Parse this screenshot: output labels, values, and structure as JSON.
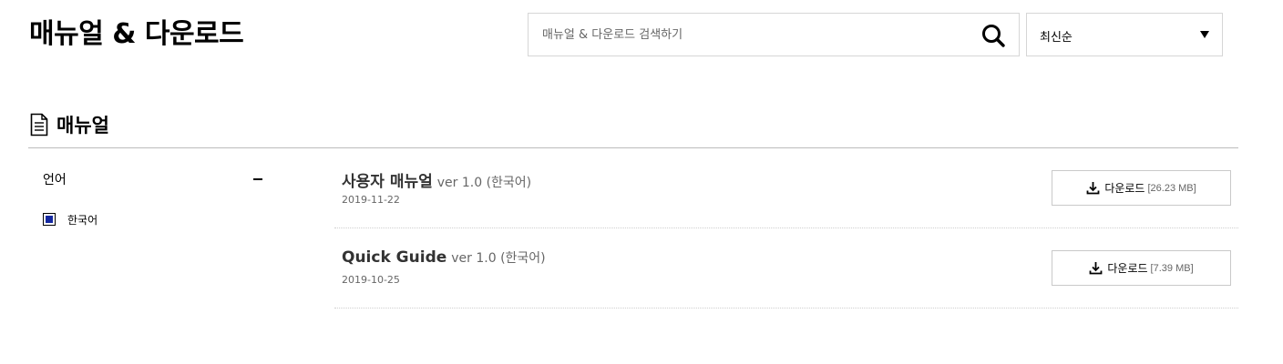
{
  "header": {
    "title": "매뉴얼 & 다운로드",
    "search": {
      "placeholder": "매뉴얼 & 다운로드 검색하기",
      "value": "",
      "icon": "search-icon"
    },
    "sort": {
      "selected": "최신순",
      "icon": "caret-down-icon"
    }
  },
  "section": {
    "icon": "document-icon",
    "title": "매뉴얼"
  },
  "filters": {
    "label": "언어",
    "collapse_icon": "minus-icon",
    "options": [
      {
        "label": "한국어",
        "checked": true,
        "color": "#1428a0"
      }
    ]
  },
  "manuals": [
    {
      "title": "사용자 매뉴얼",
      "version": "ver 1.0 (한국어)",
      "date": "2019-11-22",
      "download_label": "다운로드",
      "download_size": "[26.23 MB]"
    },
    {
      "title": "Quick Guide",
      "version": "ver 1.0 (한국어)",
      "date": "2019-10-25",
      "download_label": "다운로드",
      "download_size": "[7.39 MB]"
    }
  ],
  "colors": {
    "accent": "#1428a0",
    "border": "#d6d6d6",
    "divider": "#bcbcbc"
  }
}
